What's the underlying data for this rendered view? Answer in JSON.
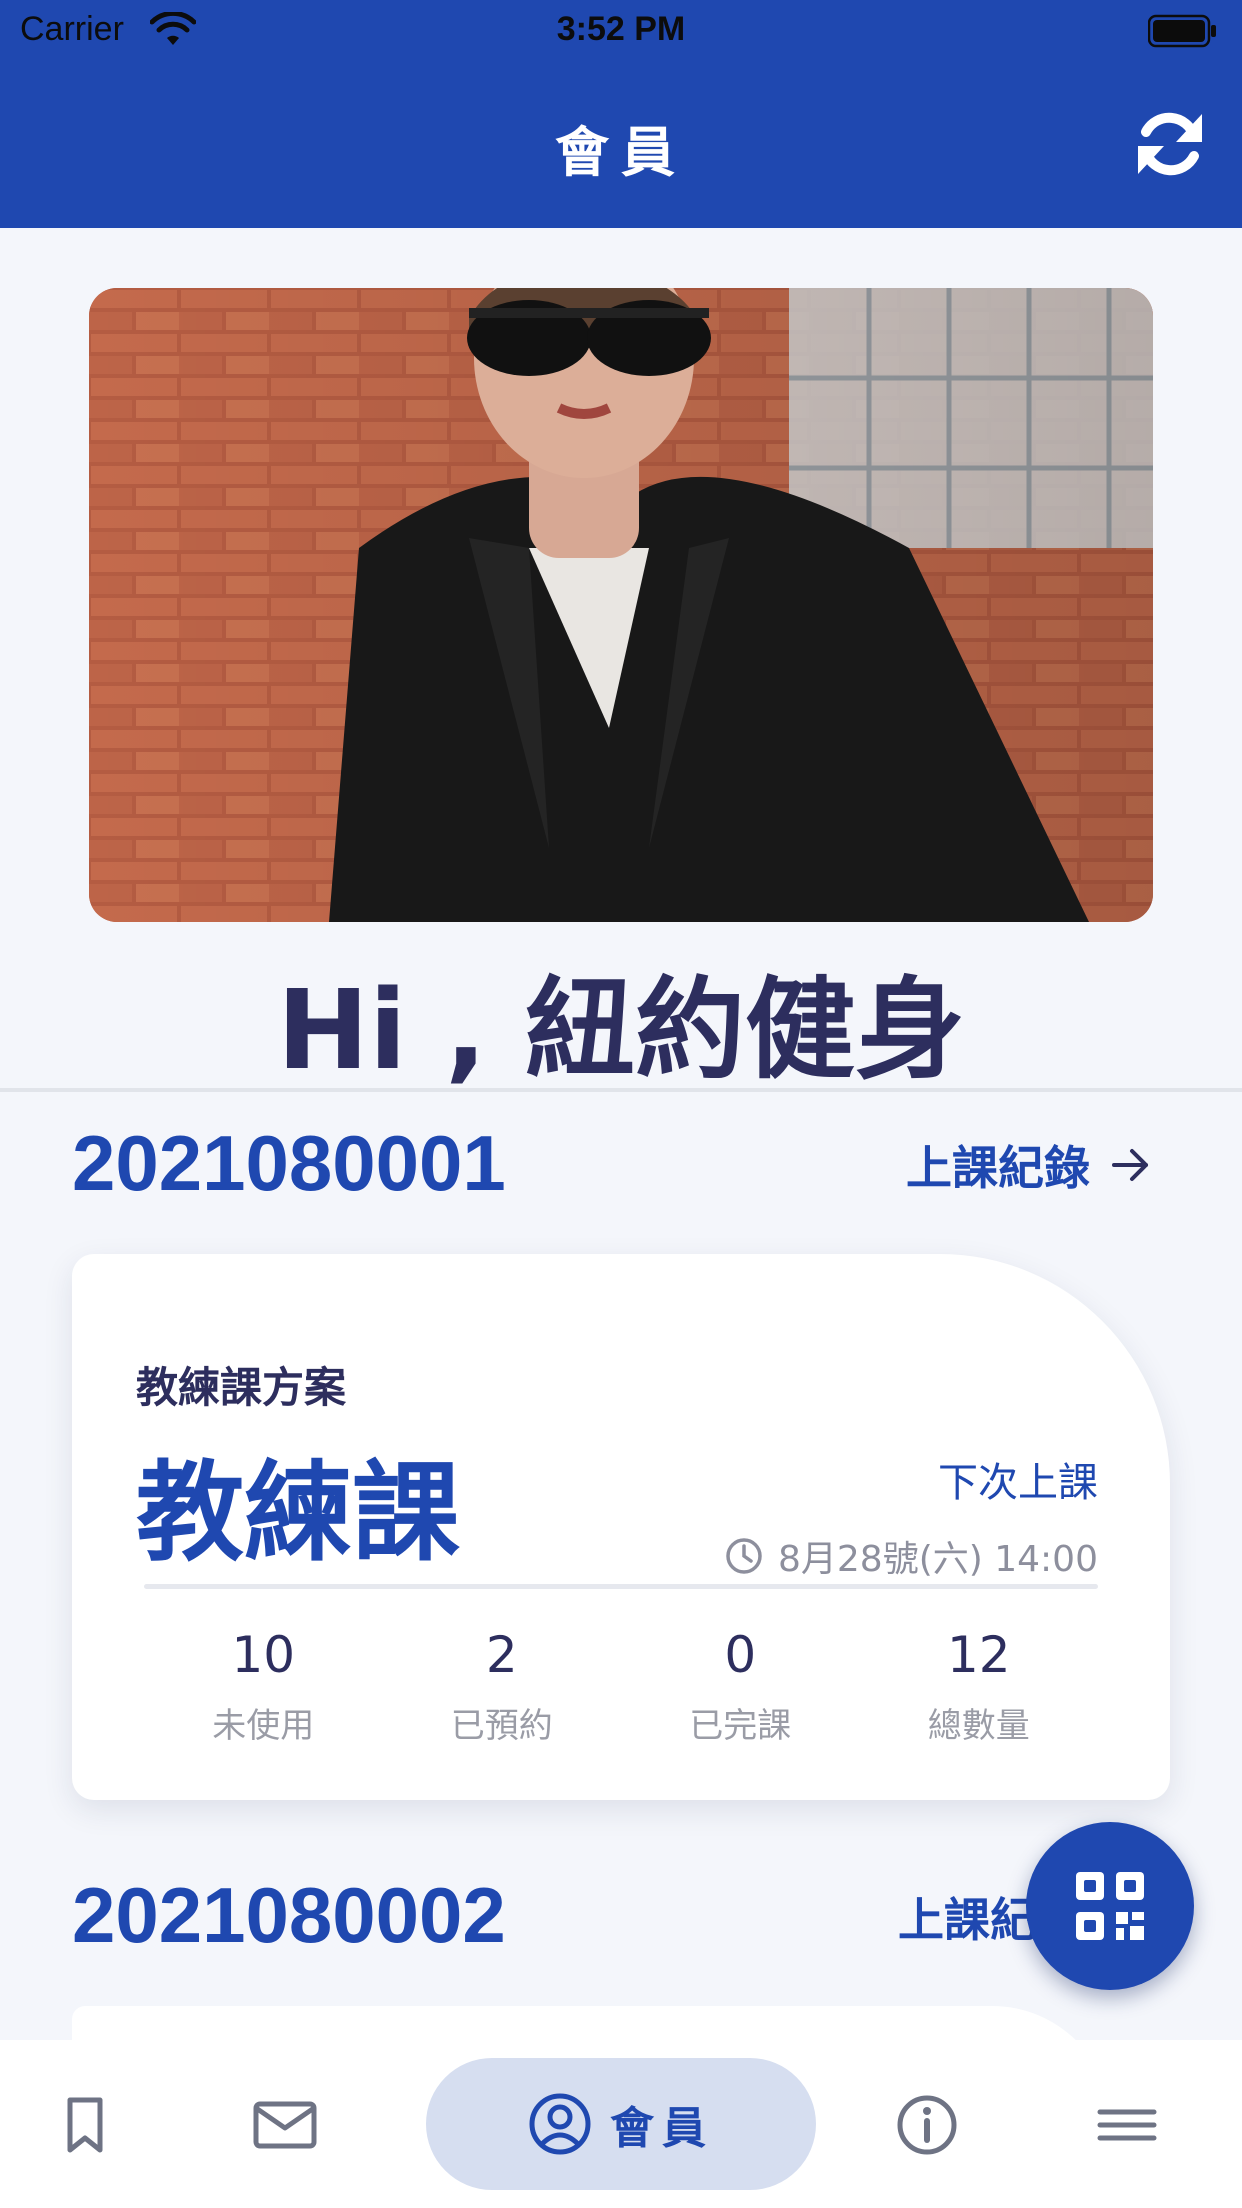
{
  "status_bar": {
    "carrier": "Carrier",
    "time": "3:52 PM"
  },
  "header": {
    "title": "會員"
  },
  "greeting": "Hi , 紐約健身",
  "memberships": [
    {
      "number": "2021080001",
      "record_link": "上課紀錄",
      "plan_label": "教練課方案",
      "plan_name": "教練課",
      "next_class_label": "下次上課",
      "next_class_time": "8月28號(六) 14:00",
      "stats": [
        {
          "value": "10",
          "label": "未使用"
        },
        {
          "value": "2",
          "label": "已預約"
        },
        {
          "value": "0",
          "label": "已完課"
        },
        {
          "value": "12",
          "label": "總數量"
        }
      ]
    },
    {
      "number": "2021080002",
      "record_link": "上課紀"
    }
  ],
  "tab_bar": {
    "items": [
      {
        "icon": "bookmark-icon"
      },
      {
        "icon": "mail-icon"
      },
      {
        "icon": "user-circle-icon",
        "label": "會員",
        "active": true
      },
      {
        "icon": "info-icon"
      },
      {
        "icon": "menu-icon"
      }
    ]
  },
  "colors": {
    "primary": "#1f48b0",
    "active_tab_bg": "#d6def0",
    "background": "#f4f6fb"
  }
}
